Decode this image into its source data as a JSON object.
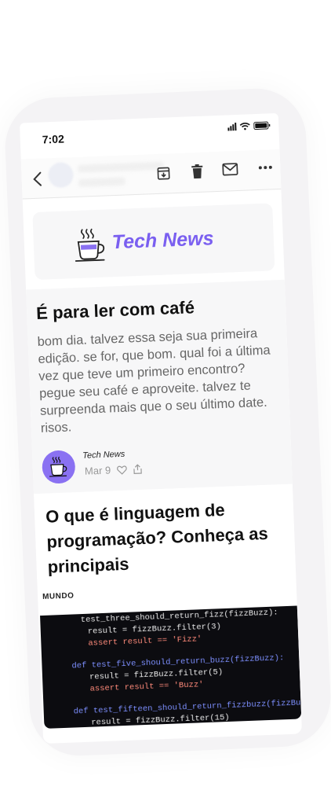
{
  "status_bar": {
    "time": "7:02"
  },
  "toolbar": {
    "back_icon": "chevron-left-icon",
    "archive_icon": "archive-download-icon",
    "delete_icon": "trash-icon",
    "mail_icon": "envelope-icon",
    "more_icon": "more-horizontal-icon"
  },
  "newsletter": {
    "logo_text": "Tech News",
    "logo_icon": "coffee-cup-icon",
    "brand_color": "#7a5ff0"
  },
  "article1": {
    "title": "É para ler com café",
    "summary": "bom dia. talvez essa seja sua primeira edição. se for, que bom. qual foi a última vez que teve um primeiro encontro? pegue seu café e aproveite. talvez te surpreenda mais que o seu último date. risos.",
    "author": "Tech News",
    "date": "Mar 9",
    "avatar_color": "#8a71f2"
  },
  "article2": {
    "title": "O que é linguagem de programação? Conheça as principais"
  },
  "section": {
    "label": "MUNDO"
  },
  "code_snippet": [
    "test_three_should_return_fizz(fizzBuzz):",
    "result = fizzBuzz.filter(3)",
    "assert result == 'Fizz'",
    "def test_five_should_return_buzz(fizzBuzz):",
    "result = fizzBuzz.filter(5)",
    "assert result == 'Buzz'",
    "def test_fifteen_should_return_fizzbuzz(fizzBuzz):",
    "result = fizzBuzz.filter(15)"
  ]
}
